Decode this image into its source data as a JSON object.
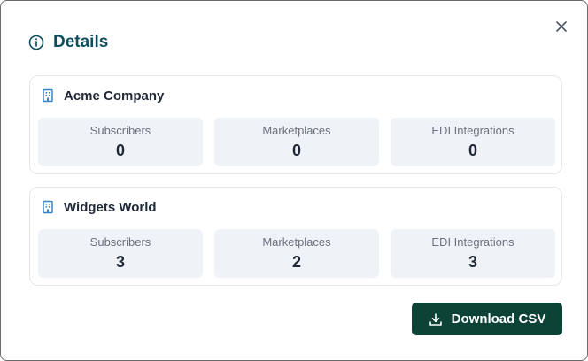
{
  "dialog": {
    "title": "Details",
    "close_icon": "close-icon",
    "info_icon": "info-icon"
  },
  "companies": [
    {
      "name": "Acme Company",
      "icon": "building-icon",
      "stats": [
        {
          "label": "Subscribers",
          "value": "0"
        },
        {
          "label": "Marketplaces",
          "value": "0"
        },
        {
          "label": "EDI Integrations",
          "value": "0"
        }
      ]
    },
    {
      "name": "Widgets World",
      "icon": "building-icon",
      "stats": [
        {
          "label": "Subscribers",
          "value": "3"
        },
        {
          "label": "Marketplaces",
          "value": "2"
        },
        {
          "label": "EDI Integrations",
          "value": "3"
        }
      ]
    }
  ],
  "actions": {
    "download_label": "Download CSV",
    "download_icon": "download-icon"
  },
  "colors": {
    "title": "#0b4e5e",
    "button_bg": "#0d4236",
    "icon_blue": "#3b82c4",
    "stat_bg": "#eff2f6"
  }
}
